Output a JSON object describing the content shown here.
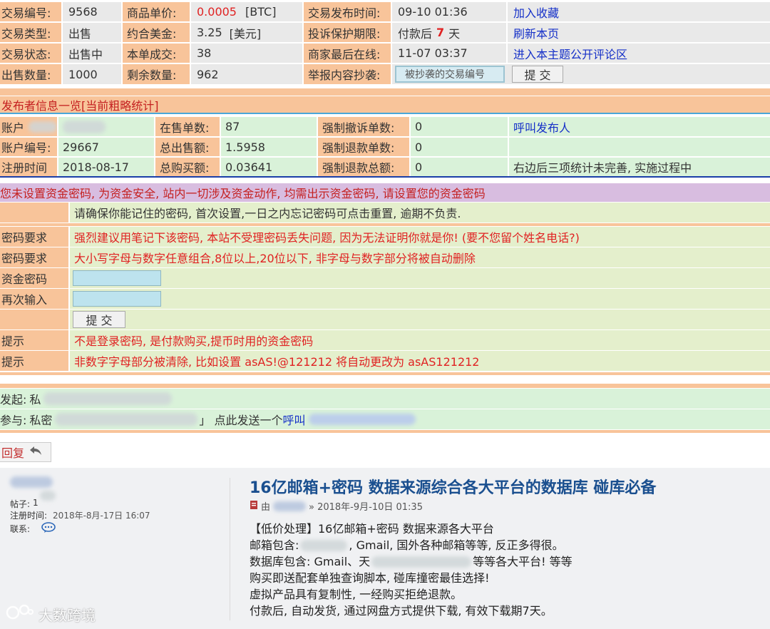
{
  "trade": {
    "r1": {
      "l1": "交易编号:",
      "v1": "9568",
      "l2": "商品单价:",
      "price": "0.0005",
      "unit": "[BTC]",
      "l3": "交易发布时间:",
      "v3": "09-10 01:36",
      "link": "加入收藏"
    },
    "r2": {
      "l1": "交易类型:",
      "v1": "出售",
      "l2": "约合美金:",
      "v2": "3.25",
      "unit": "[美元]",
      "l3": "投诉保护期限:",
      "v3a": "付款后",
      "days": "7",
      "v3b": "天",
      "link": "刷新本页"
    },
    "r3": {
      "l1": "交易状态:",
      "v1": "出售中",
      "l2": "本单成交:",
      "v2": "38",
      "l3": "商家最后在线:",
      "v3": "11-07 03:37",
      "link": "进入本主题公开评论区"
    },
    "r4": {
      "l1": "出售数量:",
      "v1": "1000",
      "l2": "剩余数量:",
      "v2": "962",
      "l3": "举报内容抄袭:",
      "placeholder": "被抄袭的交易编号",
      "button": "提 交"
    }
  },
  "publisher": {
    "header": "发布者信息一览[当前粗略统计]",
    "r1": {
      "l1": "账户",
      "l2": "在售单数:",
      "v2": "87",
      "l3": "强制撤诉单数:",
      "v3": "0",
      "link": "呼叫发布人"
    },
    "r2": {
      "l1": "账户编号:",
      "v1": "29667",
      "l2": "总出售额:",
      "v2": "1.5958",
      "l3": "强制退款单数:",
      "v3": "0"
    },
    "r3": {
      "l1": "注册时间",
      "v1": "2018-08-17",
      "l2": "总购买额:",
      "v2": "0.03641",
      "l3": "强制退款总额:",
      "v3": "0",
      "note": "右边后三项统计未完善, 实施过程中"
    }
  },
  "fund_password": {
    "warning": "您未设置资金密码, 为资金安全, 站内一切涉及资金动作, 均需出示资金密码, 请设置您的资金密码",
    "notice": "请确保你能记住的密码, 首次设置,一日之内忘记密码可点击重置, 逾期不负责.",
    "req1_label": "密码要求",
    "req1": "强烈建议用笔记下该密码, 本站不受理密码丢失问题, 因为无法证明你就是你! (要不您留个姓名电话?)",
    "req2_label": "密码要求",
    "req2": "大小写字母与数字任意组合,8位以上,20位以下, 非字母与数字部分将被自动删除",
    "pw_label": "资金密码",
    "confirm_label": "再次输入",
    "submit": "提 交",
    "tip1_label": "提示",
    "tip1": "不是登录密码, 是付款购买,提币时用的资金密码",
    "tip2_label": "提示",
    "tip2": "非数字字母部分被清除, 比如设置 asAS!@121212 将自动更改为 asAS121212"
  },
  "discussion": {
    "initiator_label": "发起:",
    "initiator_visible": "私",
    "participant_label": "参与:",
    "participant_prefix": "私密",
    "participant_suffix": "」 点此发送一个",
    "participant_link": "呼叫"
  },
  "reply_button": "回复",
  "post": {
    "posts_label": "帖子:",
    "posts_value": "1",
    "reg_label": "注册时间:",
    "reg_value": "2018年-8月-17日 16:07",
    "contact_label": "联系:",
    "title": "16亿邮箱+密码 数据来源综合各大平台的数据库 碰库必备",
    "by": "由",
    "date": "» 2018年-9月-10日 01:35",
    "lines": [
      "【低价处理】16亿邮箱+密码 数据来源各大平台",
      "邮箱包含:",
      "数据库包含: Gmail、天",
      "购买即送配套单独查询脚本, 碰库撞密最佳选择!",
      "虚拟产品具有复制性, 一经购买拒绝退款。",
      "付款后, 自动发货, 通过网盘方式提供下载, 有效下载期7天。"
    ],
    "line2_mid": ", Gmail, 国外各种邮箱等等, 反正多得很。",
    "line3_tail": "等等各大平台! 等等"
  },
  "watermark": "大数跨境"
}
